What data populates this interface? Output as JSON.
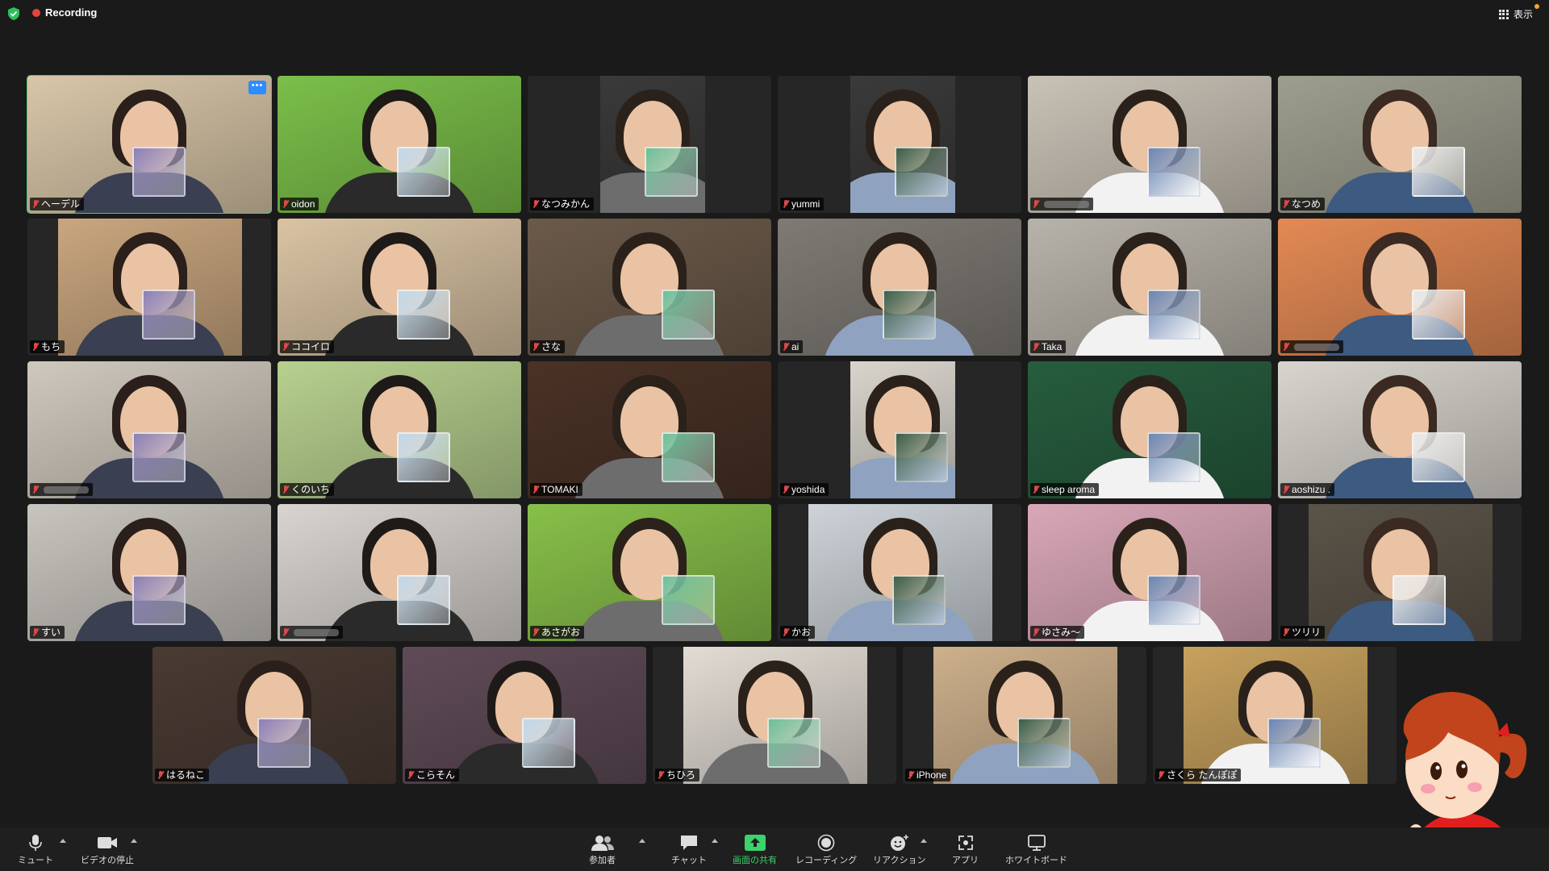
{
  "topbar": {
    "recording_label": "Recording",
    "view_label": "表示"
  },
  "participants": [
    {
      "name": "ヘーデル",
      "active": true
    },
    {
      "name": "oidon"
    },
    {
      "name": "なつみかん"
    },
    {
      "name": "yummi"
    },
    {
      "name": ""
    },
    {
      "name": "なつめ"
    },
    {
      "name": "もち"
    },
    {
      "name": "ココイロ"
    },
    {
      "name": "さな"
    },
    {
      "name": "ai"
    },
    {
      "name": "Taka"
    },
    {
      "name": ""
    },
    {
      "name": ""
    },
    {
      "name": "くのいち"
    },
    {
      "name": "TOMAKI"
    },
    {
      "name": "yoshida"
    },
    {
      "name": "sleep aroma"
    },
    {
      "name": "aoshizu ."
    },
    {
      "name": "すい"
    },
    {
      "name": ""
    },
    {
      "name": "あさがお"
    },
    {
      "name": "かお"
    },
    {
      "name": "ゆさみ〜"
    },
    {
      "name": "ツリリ"
    },
    {
      "name": "はるねこ"
    },
    {
      "name": "こらそん"
    },
    {
      "name": "ちひろ"
    },
    {
      "name": "iPhone"
    },
    {
      "name": "さくら たんぽぽ"
    }
  ],
  "toolbar": {
    "mute": "ミュート",
    "video": "ビデオの停止",
    "participants": "参加者",
    "chat": "チャット",
    "share": "画面の共有",
    "record": "レコーディング",
    "reactions": "リアクション",
    "apps": "アプリ",
    "whiteboard": "ホワイトボード"
  },
  "colors": {
    "background": "#1a1a1a",
    "active_speaker": "#3bd36b",
    "share_green": "#3bd36b",
    "recording_red": "#e8423c",
    "more_button_blue": "#2d8cff"
  },
  "icons": {
    "security": "shield-check-icon",
    "view": "grid-icon",
    "mute": "microphone-icon",
    "video": "camera-icon",
    "participants": "people-icon",
    "chat": "speech-bubble-icon",
    "share": "share-screen-arrow-icon",
    "record": "record-icon",
    "reactions": "smiley-plus-icon",
    "apps": "apps-icon",
    "whiteboard": "whiteboard-icon"
  }
}
